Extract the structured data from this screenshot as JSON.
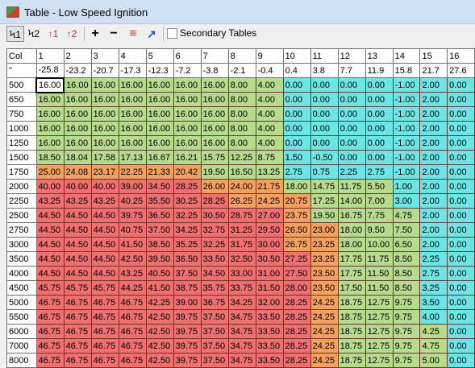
{
  "window": {
    "title": "Table - Low Speed Ignition"
  },
  "toolbar": {
    "buttons": [
      {
        "name": "view-1-button",
        "label": "Ϟ1",
        "pressed": true
      },
      {
        "name": "view-2-button",
        "label": "Ϟ2",
        "pressed": false
      },
      {
        "name": "up-1-button",
        "label": "↑1",
        "pressed": false
      },
      {
        "name": "up-2-button",
        "label": "↑2",
        "pressed": false
      },
      {
        "name": "increase-button",
        "label": "+",
        "pressed": false
      },
      {
        "name": "decrease-button",
        "label": "−",
        "pressed": false
      },
      {
        "name": "flatten-button",
        "label": "≡",
        "pressed": false
      },
      {
        "name": "graph-button",
        "label": "↗",
        "pressed": false
      }
    ],
    "secondary_tables_label": "Secondary Tables",
    "secondary_tables_checked": false
  },
  "table": {
    "corner_label": "Col",
    "units_label": "\"",
    "columns": [
      "1",
      "2",
      "3",
      "4",
      "5",
      "6",
      "7",
      "8",
      "9",
      "10",
      "11",
      "12",
      "13",
      "14",
      "15",
      "16"
    ],
    "column_values": [
      "-25.8",
      "-23.2",
      "-20.7",
      "-17.3",
      "-12.3",
      "-7.2",
      "-3.8",
      "-2.1",
      "-0.4",
      "0.4",
      "3.8",
      "7.7",
      "11.9",
      "15.8",
      "21.7",
      "27.6"
    ],
    "rows": [
      {
        "label": "500",
        "cells": [
          "16.00",
          "16.00",
          "16.00",
          "16.00",
          "16.00",
          "16.00",
          "16.00",
          "8.00",
          "4.00",
          "0.00",
          "0.00",
          "0.00",
          "0.00",
          "-1.00",
          "2.00",
          "0.00"
        ]
      },
      {
        "label": "650",
        "cells": [
          "16.00",
          "16.00",
          "16.00",
          "16.00",
          "16.00",
          "16.00",
          "16.00",
          "8.00",
          "4.00",
          "0.00",
          "0.00",
          "0.00",
          "0.00",
          "-1.00",
          "2.00",
          "0.00"
        ]
      },
      {
        "label": "750",
        "cells": [
          "16.00",
          "16.00",
          "16.00",
          "16.00",
          "16.00",
          "16.00",
          "16.00",
          "8.00",
          "4.00",
          "0.00",
          "0.00",
          "0.00",
          "0.00",
          "-1.00",
          "2.00",
          "0.00"
        ]
      },
      {
        "label": "1000",
        "cells": [
          "16.00",
          "16.00",
          "16.00",
          "16.00",
          "16.00",
          "16.00",
          "16.00",
          "8.00",
          "4.00",
          "0.00",
          "0.00",
          "0.00",
          "0.00",
          "-1.00",
          "2.00",
          "0.00"
        ]
      },
      {
        "label": "1250",
        "cells": [
          "16.00",
          "16.00",
          "16.00",
          "16.00",
          "16.00",
          "16.00",
          "16.00",
          "8.00",
          "4.00",
          "0.00",
          "0.00",
          "0.00",
          "0.00",
          "-1.00",
          "2.00",
          "0.00"
        ]
      },
      {
        "label": "1500",
        "cells": [
          "18.50",
          "18.04",
          "17.58",
          "17.13",
          "16.67",
          "16.21",
          "15.75",
          "12.25",
          "8.75",
          "1.50",
          "-0.50",
          "0.00",
          "0.00",
          "-1.00",
          "2.00",
          "0.00"
        ]
      },
      {
        "label": "1750",
        "cells": [
          "25.00",
          "24.08",
          "23.17",
          "22.25",
          "21.33",
          "20.42",
          "19.50",
          "16.50",
          "13.25",
          "2.75",
          "0.75",
          "2.25",
          "2.75",
          "-1.00",
          "2.00",
          "0.00"
        ]
      },
      {
        "label": "2000",
        "cells": [
          "40.00",
          "40.00",
          "40.00",
          "39.00",
          "34.50",
          "28.25",
          "26.00",
          "24.00",
          "21.75",
          "18.00",
          "14.75",
          "11.75",
          "5.50",
          "1.00",
          "2.00",
          "0.00"
        ]
      },
      {
        "label": "2250",
        "cells": [
          "43.25",
          "43.25",
          "43.25",
          "40.25",
          "35.50",
          "30.25",
          "28.25",
          "26.25",
          "24.25",
          "20.75",
          "17.25",
          "14.00",
          "7.00",
          "3.00",
          "2.00",
          "0.00"
        ]
      },
      {
        "label": "2500",
        "cells": [
          "44.50",
          "44.50",
          "44.50",
          "39.75",
          "36.50",
          "32.25",
          "30.50",
          "28.75",
          "27.00",
          "23.75",
          "19.50",
          "16.75",
          "7.75",
          "4.75",
          "2.00",
          "0.00"
        ]
      },
      {
        "label": "2750",
        "cells": [
          "44.50",
          "44.50",
          "44.50",
          "40.75",
          "37.50",
          "34.25",
          "32.75",
          "31.25",
          "29.50",
          "26.50",
          "23.00",
          "18.00",
          "9.50",
          "7.50",
          "2.00",
          "0.00"
        ]
      },
      {
        "label": "3000",
        "cells": [
          "44.50",
          "44.50",
          "44.50",
          "41.50",
          "38.50",
          "35.25",
          "32.25",
          "31.75",
          "30.00",
          "26.75",
          "23.25",
          "18.00",
          "10.00",
          "6.50",
          "2.00",
          "0.00"
        ]
      },
      {
        "label": "3500",
        "cells": [
          "44.50",
          "44.50",
          "44.50",
          "42.50",
          "39.50",
          "36.50",
          "33.50",
          "32.50",
          "30.50",
          "27.25",
          "23.25",
          "17.75",
          "11.75",
          "8.50",
          "2.25",
          "0.00"
        ]
      },
      {
        "label": "4000",
        "cells": [
          "44.50",
          "44.50",
          "44.50",
          "43.25",
          "40.50",
          "37.50",
          "34.50",
          "33.00",
          "31.00",
          "27.50",
          "23.50",
          "17.75",
          "11.50",
          "8.50",
          "2.75",
          "0.00"
        ]
      },
      {
        "label": "4500",
        "cells": [
          "45.75",
          "45.75",
          "45.75",
          "44.25",
          "41.50",
          "38.75",
          "35.75",
          "33.75",
          "31.50",
          "28.00",
          "23.50",
          "17.50",
          "11.50",
          "8.50",
          "3.25",
          "0.00"
        ]
      },
      {
        "label": "5000",
        "cells": [
          "46.75",
          "46.75",
          "46.75",
          "46.75",
          "42.25",
          "39.00",
          "36.75",
          "34.25",
          "32.00",
          "28.25",
          "24.25",
          "18.75",
          "12.75",
          "9.75",
          "3.50",
          "0.00"
        ]
      },
      {
        "label": "5500",
        "cells": [
          "46.75",
          "46.75",
          "46.75",
          "46.75",
          "42.50",
          "39.75",
          "37.50",
          "34.75",
          "33.50",
          "28.25",
          "24.25",
          "18.75",
          "12.75",
          "9.75",
          "4.00",
          "0.00"
        ]
      },
      {
        "label": "6000",
        "cells": [
          "46.75",
          "46.75",
          "46.75",
          "46.75",
          "42.50",
          "39.75",
          "37.50",
          "34.75",
          "33.50",
          "28.25",
          "24.25",
          "18.75",
          "12.75",
          "9.75",
          "4.25",
          "0.00"
        ]
      },
      {
        "label": "7000",
        "cells": [
          "46.75",
          "46.75",
          "46.75",
          "46.75",
          "42.50",
          "39.75",
          "37.50",
          "34.75",
          "33.50",
          "28.25",
          "24.25",
          "18.75",
          "12.75",
          "9.75",
          "4.75",
          "0.00"
        ]
      },
      {
        "label": "8000",
        "cells": [
          "46.75",
          "46.75",
          "46.75",
          "46.75",
          "42.50",
          "39.75",
          "37.50",
          "34.75",
          "33.50",
          "28.25",
          "24.25",
          "18.75",
          "12.75",
          "9.75",
          "5.00",
          "0.00"
        ]
      }
    ],
    "selected_cell": {
      "row": 0,
      "col": 0
    },
    "colors": {
      "cool": "#6ae6e6",
      "mid": "#b6db8a",
      "warm": "#f5a05c",
      "hot": "#f07070",
      "selected": "#ffffff"
    }
  }
}
